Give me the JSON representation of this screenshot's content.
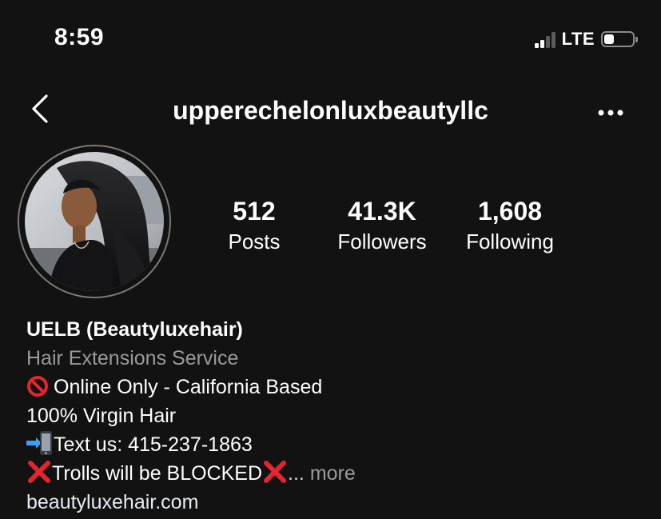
{
  "status_bar": {
    "time": "8:59",
    "network": "LTE",
    "signal_bars_active": 2,
    "signal_bars_total": 4,
    "battery_level": 0.35
  },
  "header": {
    "username": "upperechelonluxbeautyllc",
    "back_icon": "chevron-left-icon",
    "more_icon": "more-horizontal-icon"
  },
  "stats": [
    {
      "value": "512",
      "label": "Posts"
    },
    {
      "value": "41.3K",
      "label": "Followers"
    },
    {
      "value": "1,608",
      "label": "Following"
    }
  ],
  "bio": {
    "display_name": "UELB (Beautyluxehair)",
    "category": "Hair Extensions Service",
    "line1_icon": "prohibited-icon",
    "line1": "Online Only - California Based",
    "line2": "100% Virgin Hair",
    "line3_icon": "mobile-phone-arrow-icon",
    "line3": "Text us: 415-237-1863",
    "line4_icon": "cross-mark-icon",
    "line4": "Trolls will be BLOCKED",
    "ellipsis": "...",
    "more": "more",
    "website": "beautyluxehair.com"
  },
  "colors": {
    "background": "#121212",
    "text": "#ffffff",
    "secondary_text": "#9a9a9a",
    "accent_red": "#e3252f",
    "phone_arrow_blue": "#3aa0ff"
  }
}
